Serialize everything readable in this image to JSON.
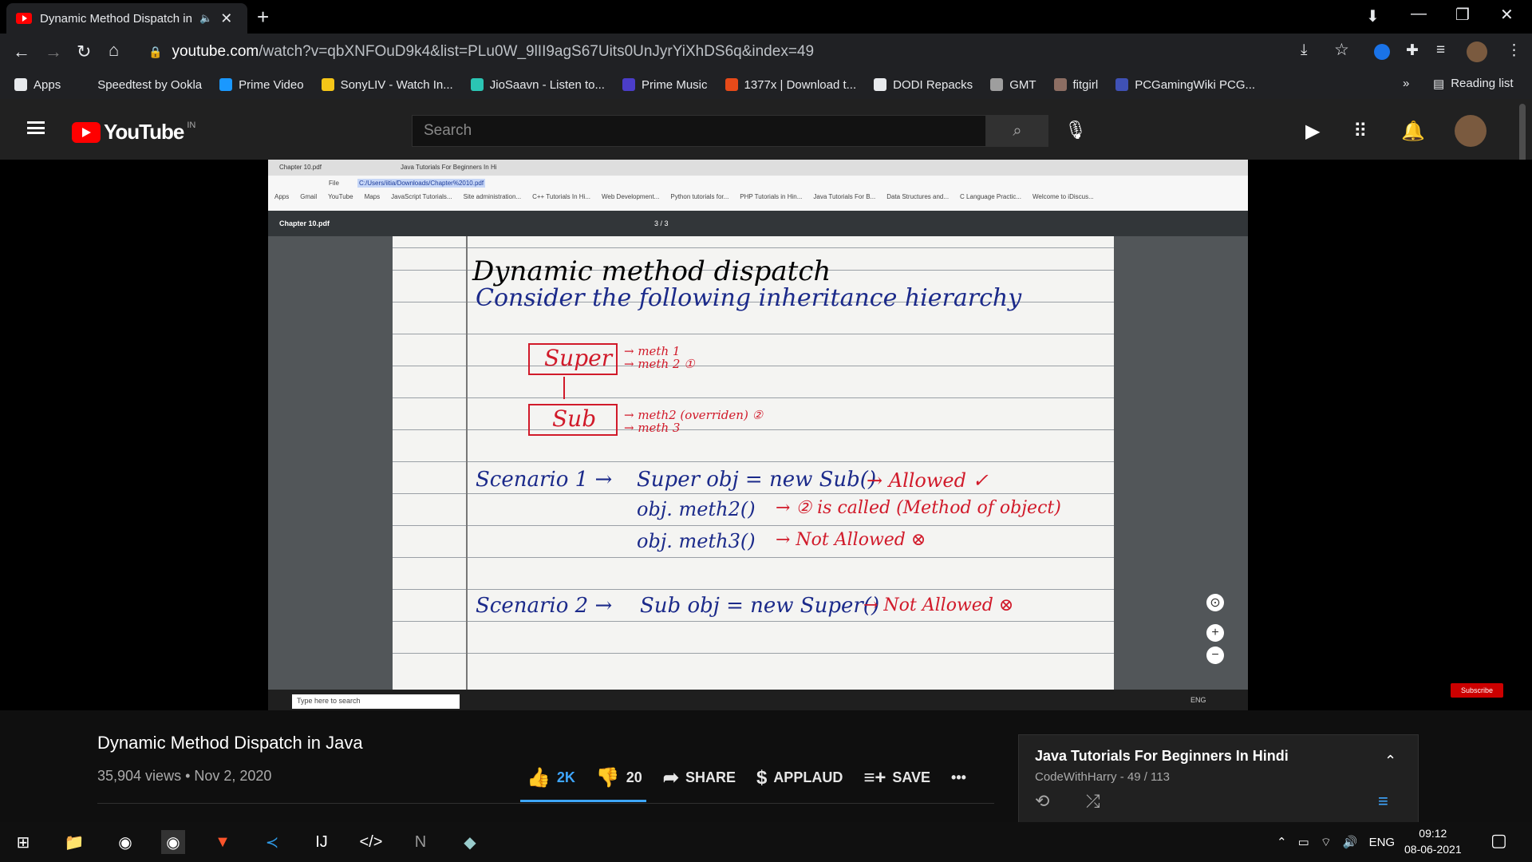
{
  "browser": {
    "tab_title": "Dynamic Method Dispatch in",
    "url_host": "youtube.com",
    "url_rest": "/watch?v=qbXNFOuD9k4&list=PLu0W_9lII9agS67Uits0UnJyrYiXhDS6q&index=49",
    "bookmarks": [
      {
        "label": "Apps",
        "color": "#e8eaed"
      },
      {
        "label": "Speedtest by Ookla",
        "color": "#202124"
      },
      {
        "label": "Prime Video",
        "color": "#1a98ff"
      },
      {
        "label": "SonyLIV - Watch In...",
        "color": "#f5c518"
      },
      {
        "label": "JioSaavn - Listen to...",
        "color": "#2bc5b4"
      },
      {
        "label": "Prime Music",
        "color": "#4b3dc9"
      },
      {
        "label": "1377x | Download t...",
        "color": "#e64a19"
      },
      {
        "label": "DODI Repacks",
        "color": "#e8eaed"
      },
      {
        "label": "GMT",
        "color": "#9e9e9e"
      },
      {
        "label": "fitgirl",
        "color": "#8d6e63"
      },
      {
        "label": "PCGamingWiki PCG...",
        "color": "#3f51b5"
      }
    ],
    "more_label": "»",
    "reading_list": "Reading list"
  },
  "youtube": {
    "logo_text": "YouTube",
    "country": "IN",
    "search_placeholder": "Search"
  },
  "video": {
    "inner_tab1": "Chapter 10.pdf",
    "inner_tab2": "Java Tutorials For Beginners In Hi",
    "inner_url": "C:/Users/iitia/Downloads/Chapter%2010.pdf",
    "inner_file_label": "File",
    "inner_bookmarks": [
      "Apps",
      "Gmail",
      "YouTube",
      "Maps",
      "JavaScript Tutorials...",
      "Site administration...",
      "C++ Tutorials In Hi...",
      "Web Development...",
      "Python tutorials for...",
      "PHP Tutorials in Hin...",
      "Java Tutorials For B...",
      "Data Structures and...",
      "C Language Practic...",
      "Welcome to iDiscus..."
    ],
    "pdf_name": "Chapter 10.pdf",
    "pdf_page": "3 / 3",
    "inner_search": "Type here to search",
    "inner_tray_lang": "ENG",
    "subscribe_badge": "Subscribe",
    "notes": {
      "heading": "Dynamic method dispatch",
      "line2": "Consider the following inheritance hierarchy",
      "super": "Super",
      "super_m": "→ meth 1\n→ meth 2 ①",
      "sub": "Sub",
      "sub_m": "→ meth2 (overriden) ②\n→ meth 3",
      "s1": "Scenario 1 →",
      "s1a": "Super obj = new Sub()",
      "s1a_r": "→ Allowed ✓",
      "s1b": "obj. meth2()",
      "s1b_r": "→ ② is called (Method of object)",
      "s1c": "obj. meth3()",
      "s1c_r": "→ Not Allowed ⊗",
      "s2": "Scenario 2 →",
      "s2a": "Sub obj = new Super()",
      "s2a_r": "→ Not Allowed ⊗"
    }
  },
  "details": {
    "title": "Dynamic Method Dispatch in Java",
    "meta": "35,904 views • Nov 2, 2020",
    "likes": "2K",
    "dislikes": "20",
    "share": "SHARE",
    "applaud": "APPLAUD",
    "save": "SAVE",
    "more": "•••"
  },
  "playlist": {
    "title": "Java Tutorials For Beginners In Hindi",
    "sub": "CodeWithHarry - 49 / 113"
  },
  "taskbar": {
    "lang": "ENG",
    "time": "09:12",
    "date": "08-06-2021"
  }
}
